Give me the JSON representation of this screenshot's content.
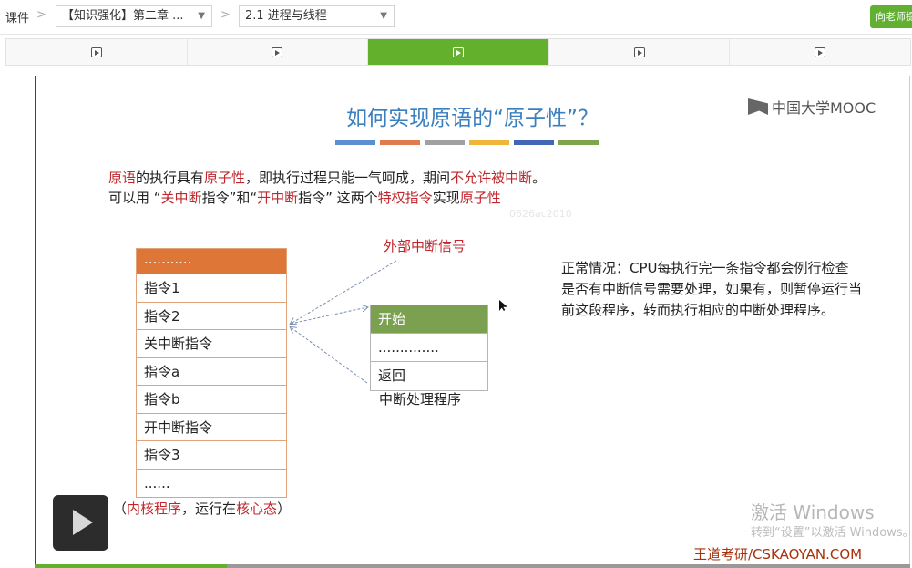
{
  "nav": {
    "root": "课件",
    "sep": ">",
    "chapter_select": "【知识强化】第二章 ...",
    "section_select": "2.1 进程与线程",
    "ask_button": "向老师提问",
    "caret": "▼"
  },
  "units": [
    {
      "icon": "video-unit-icon",
      "active": false
    },
    {
      "icon": "video-unit-icon",
      "active": false
    },
    {
      "icon": "video-unit-icon",
      "active": true
    },
    {
      "icon": "video-unit-icon",
      "active": false
    },
    {
      "icon": "video-unit-icon",
      "active": false
    }
  ],
  "slide": {
    "title": "如何实现原语的“原子性”？",
    "bar_colors": [
      "#5b8fd0",
      "#e07b4f",
      "#a0a0a0",
      "#f0b63a",
      "#3f67b5",
      "#7ea54e"
    ],
    "logo": "中国大学MOOC",
    "line1": [
      {
        "text": "原语",
        "red": true
      },
      {
        "text": "的执行具有",
        "red": false
      },
      {
        "text": "原子性",
        "red": true
      },
      {
        "text": "，即执行过程只能一气呵成，期间",
        "red": false
      },
      {
        "text": "不允许被中断",
        "red": true
      },
      {
        "text": "。",
        "red": false
      }
    ],
    "line2": [
      {
        "text": "可以用 “",
        "red": false
      },
      {
        "text": "关中断",
        "red": true
      },
      {
        "text": "指令”和“",
        "red": false
      },
      {
        "text": "开中断",
        "red": true
      },
      {
        "text": "指令” 这两个",
        "red": false
      },
      {
        "text": "特权指令",
        "red": true
      },
      {
        "text": "实现",
        "red": false
      },
      {
        "text": "原子性",
        "red": true
      }
    ],
    "ghost_text": "0626ac2010",
    "external_signal": "外部中断信号",
    "instructions": [
      "...........",
      "指令1",
      "指令2",
      "关中断指令",
      "指令a",
      "指令b",
      "开中断指令",
      "指令3",
      "......"
    ],
    "handler_rows": [
      "开始",
      "..............",
      "返回"
    ],
    "handler_caption": "中断处理程序",
    "normal_case": "正常情况：CPU每执行完一条指令都会例行检查是否有中断信号需要处理，如果有，则暂停运行当前这段程序，转而执行相应的中断处理程序。",
    "kernel_note": [
      {
        "text": "（",
        "red": false
      },
      {
        "text": "内核程序",
        "red": true
      },
      {
        "text": "，运行在",
        "red": false
      },
      {
        "text": "核心态",
        "red": true
      },
      {
        "text": "）",
        "red": false
      }
    ],
    "watermark": "王道考研/CSKAOYAN.COM"
  },
  "windows_activation": {
    "line1": "激活 Windows",
    "line2": "转到“设置”以激活 Windows。"
  },
  "player": {
    "play_icon": "play-icon",
    "progress": 0.22
  }
}
